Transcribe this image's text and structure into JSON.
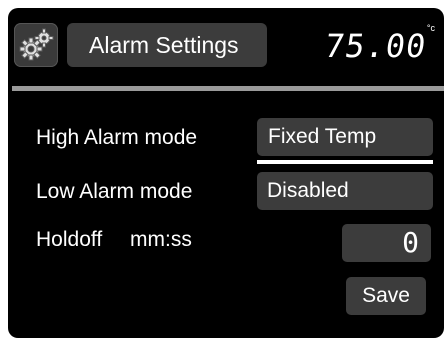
{
  "header": {
    "title": "Alarm Settings",
    "temperature": "75.00",
    "unit": "°c",
    "settings_icon": "gears-icon"
  },
  "form": {
    "high_alarm": {
      "label": "High Alarm mode",
      "value": "Fixed Temp"
    },
    "low_alarm": {
      "label": "Low Alarm mode",
      "value": "Disabled"
    },
    "holdoff": {
      "label": "Holdoff",
      "unit": "mm:ss",
      "value": "0"
    },
    "save_label": "Save"
  }
}
